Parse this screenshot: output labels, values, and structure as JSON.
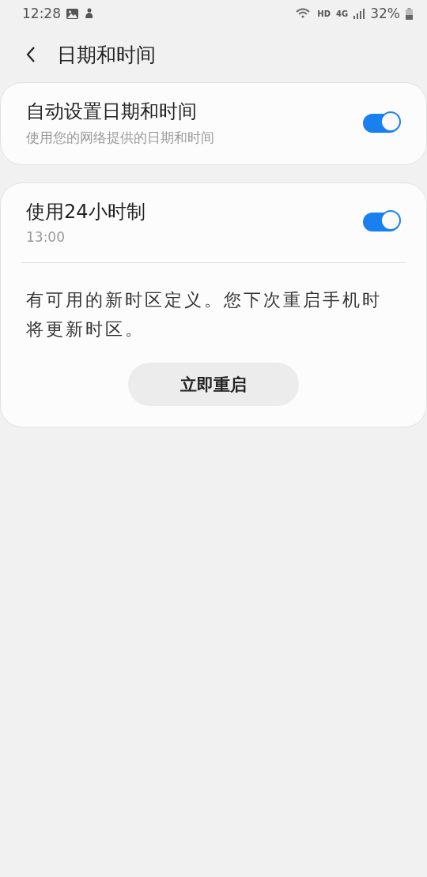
{
  "status_bar": {
    "time": "12:28",
    "hd": "HD",
    "network": "4G",
    "battery": "32%"
  },
  "header": {
    "title": "日期和时间"
  },
  "settings": [
    {
      "kind": "switch",
      "title": "自动设置日期和时间",
      "subtitle": "使用您的网络提供的日期和时间",
      "on": true
    },
    {
      "kind": "switch",
      "title": "使用24小时制",
      "subtitle": "13:00",
      "on": true,
      "notice": "有可用的新时区定义。您下次重启手机时将更新时区。",
      "button": "立即重启"
    }
  ]
}
